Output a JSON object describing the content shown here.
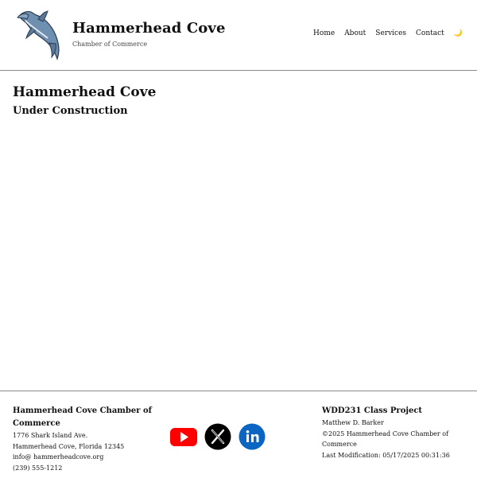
{
  "header": {
    "logo_icon": "hammerhead-shark-logo",
    "title": "Hammerhead Cove",
    "subtitle": "Chamber of Commerce"
  },
  "nav": {
    "items": [
      {
        "label": "Home"
      },
      {
        "label": "About"
      },
      {
        "label": "Services"
      },
      {
        "label": "Contact"
      }
    ],
    "theme_toggle_icon": "moon-icon",
    "theme_toggle_glyph": "🌙"
  },
  "main": {
    "title": "Hammerhead Cove",
    "subtitle": "Under Construction"
  },
  "footer": {
    "contact": {
      "org": "Hammerhead Cove Chamber of Commerce",
      "address1": "1776 Shark Island Ave.",
      "address2": "Hammerhead Cove, Florida 12345",
      "email": "info@ hammerheadcove.org",
      "phone": "(239) 555-1212"
    },
    "social": [
      {
        "name": "youtube-icon",
        "color": "#ff0000"
      },
      {
        "name": "x-icon",
        "color": "#000000"
      },
      {
        "name": "linkedin-icon",
        "color": "#0a66c2"
      }
    ],
    "project": {
      "title": "WDD231 Class Project",
      "author": "Matthew D. Barker",
      "copyright": "©2025 Hammerhead Cove Chamber of Commerce",
      "last_modified": "Last Modification: 05/17/2025 00:31:36"
    }
  }
}
